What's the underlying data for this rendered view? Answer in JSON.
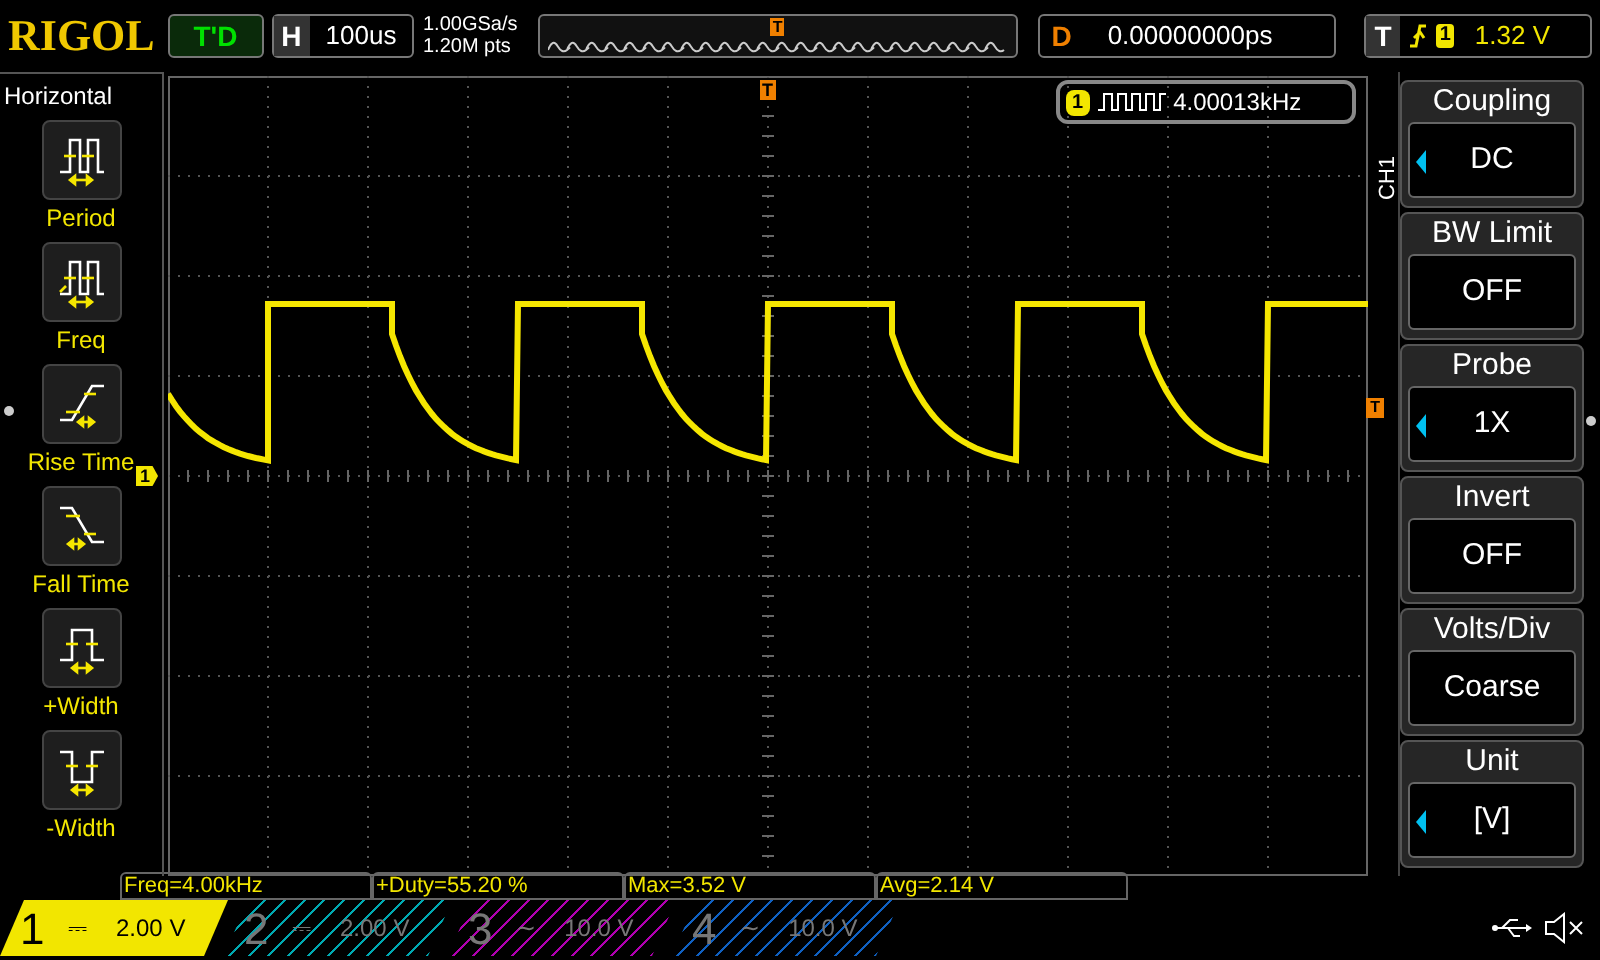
{
  "header": {
    "logo": "RIGOL",
    "run_state": "T'D",
    "timebase": {
      "label": "H",
      "value": "100us"
    },
    "sample_rate": "1.00GSa/s",
    "memory_depth": "1.20M pts",
    "trigger_position_marker": "T",
    "delay": {
      "label": "D",
      "value": "0.00000000ps"
    },
    "trigger": {
      "label": "T",
      "source": "1",
      "level": "1.32 V"
    }
  },
  "left_menu": {
    "title": "Horizontal",
    "items": [
      {
        "kind": "period",
        "label": "Period"
      },
      {
        "kind": "freq",
        "label": "Freq"
      },
      {
        "kind": "rise",
        "label": "Rise Time"
      },
      {
        "kind": "fall",
        "label": "Fall Time"
      },
      {
        "kind": "pwidth",
        "label": "+Width"
      },
      {
        "kind": "nwidth",
        "label": "-Width"
      }
    ]
  },
  "scope": {
    "trigger_top_marker": "T",
    "channel_marker": "1",
    "trigger_level_marker": "T",
    "frequency_counter": {
      "channel": "1",
      "value": "4.00013kHz"
    }
  },
  "right_menu": {
    "channel_label": "CH1",
    "items": [
      {
        "title": "Coupling",
        "value": "DC",
        "has_arrow": true
      },
      {
        "title": "BW Limit",
        "value": "OFF",
        "has_arrow": false
      },
      {
        "title": "Probe",
        "value": "1X",
        "has_arrow": true
      },
      {
        "title": "Invert",
        "value": "OFF",
        "has_arrow": false
      },
      {
        "title": "Volts/Div",
        "value": "Coarse",
        "has_arrow": false
      },
      {
        "title": "Unit",
        "value": "[V]",
        "has_arrow": true
      }
    ]
  },
  "measurements": [
    "Freq=4.00kHz",
    "+Duty=55.20 %",
    "Max=3.52 V",
    "Avg=2.14 V"
  ],
  "channels": [
    {
      "number": "1",
      "coupling": "⎓",
      "scale": "2.00 V",
      "selected": true,
      "color": "#f2e600"
    },
    {
      "number": "2",
      "coupling": "⎓",
      "scale": "2.00 V",
      "selected": false,
      "color": "#00a8b0"
    },
    {
      "number": "3",
      "coupling": "~",
      "scale": "10.0 V",
      "selected": false,
      "color": "#b000b0"
    },
    {
      "number": "4",
      "coupling": "~",
      "scale": "10.0 V",
      "selected": false,
      "color": "#1060c0"
    }
  ]
}
